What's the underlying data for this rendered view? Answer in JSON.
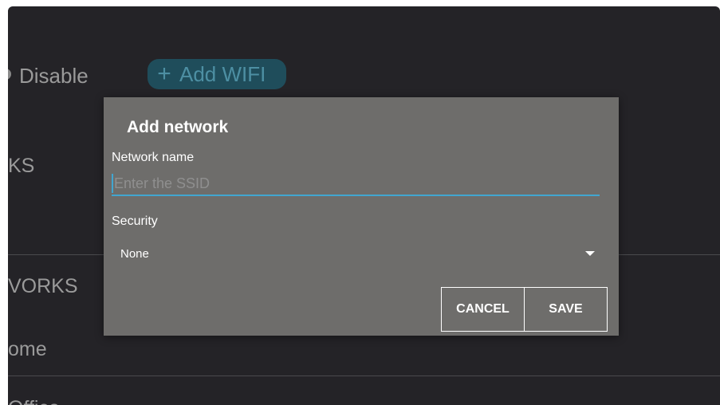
{
  "background": {
    "disable_label": "Disable",
    "add_wifi_icon": "+",
    "add_wifi_label": "Add WIFI",
    "section_saved": "KS",
    "section_available": "VORKS",
    "network_items": [
      "ome",
      "Office"
    ]
  },
  "dialog": {
    "title": "Add network",
    "network_name_label": "Network name",
    "ssid_placeholder": "Enter the SSID",
    "ssid_value": "",
    "security_label": "Security",
    "security_value": "None",
    "dropdown_icon": "caret-down-icon",
    "cancel_label": "CANCEL",
    "save_label": "SAVE"
  },
  "colors": {
    "screen_bg": "#242327",
    "dialog_bg": "#6e6d6b",
    "accent": "#41a6d0",
    "add_wifi_bg": "#1f4d5b"
  }
}
